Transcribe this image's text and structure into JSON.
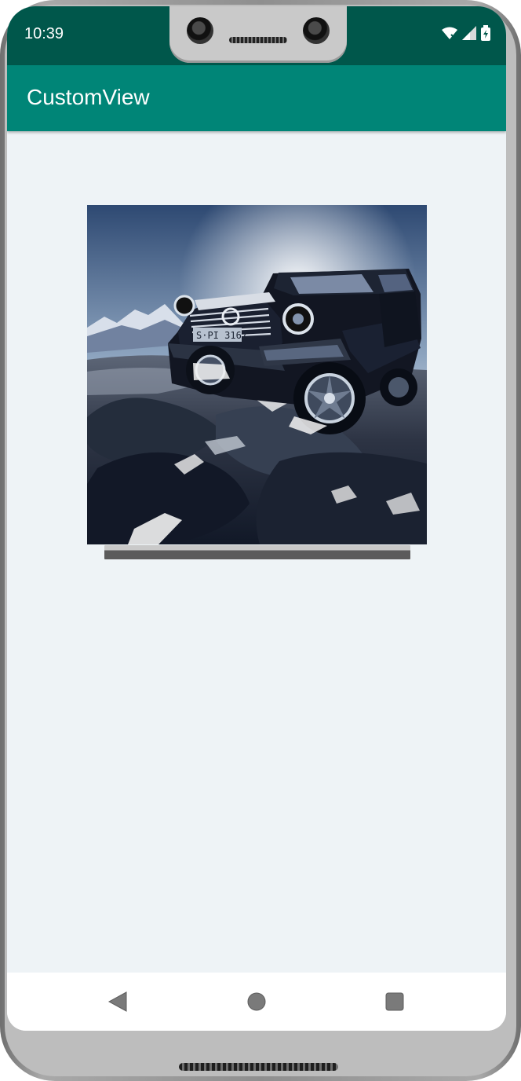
{
  "status_bar": {
    "time": "10:39",
    "icons": [
      "wifi-icon",
      "signal-icon",
      "battery-icon"
    ]
  },
  "app_bar": {
    "title": "CustomView"
  },
  "content": {
    "image": "off-road SUV on rocky terrain"
  },
  "navigation": {
    "buttons": [
      "back-icon",
      "home-icon",
      "recents-icon"
    ]
  },
  "colors": {
    "status_bar": "#00574b",
    "app_bar": "#008577",
    "background": "#eef3f6",
    "nav_bar": "#ffffff"
  }
}
